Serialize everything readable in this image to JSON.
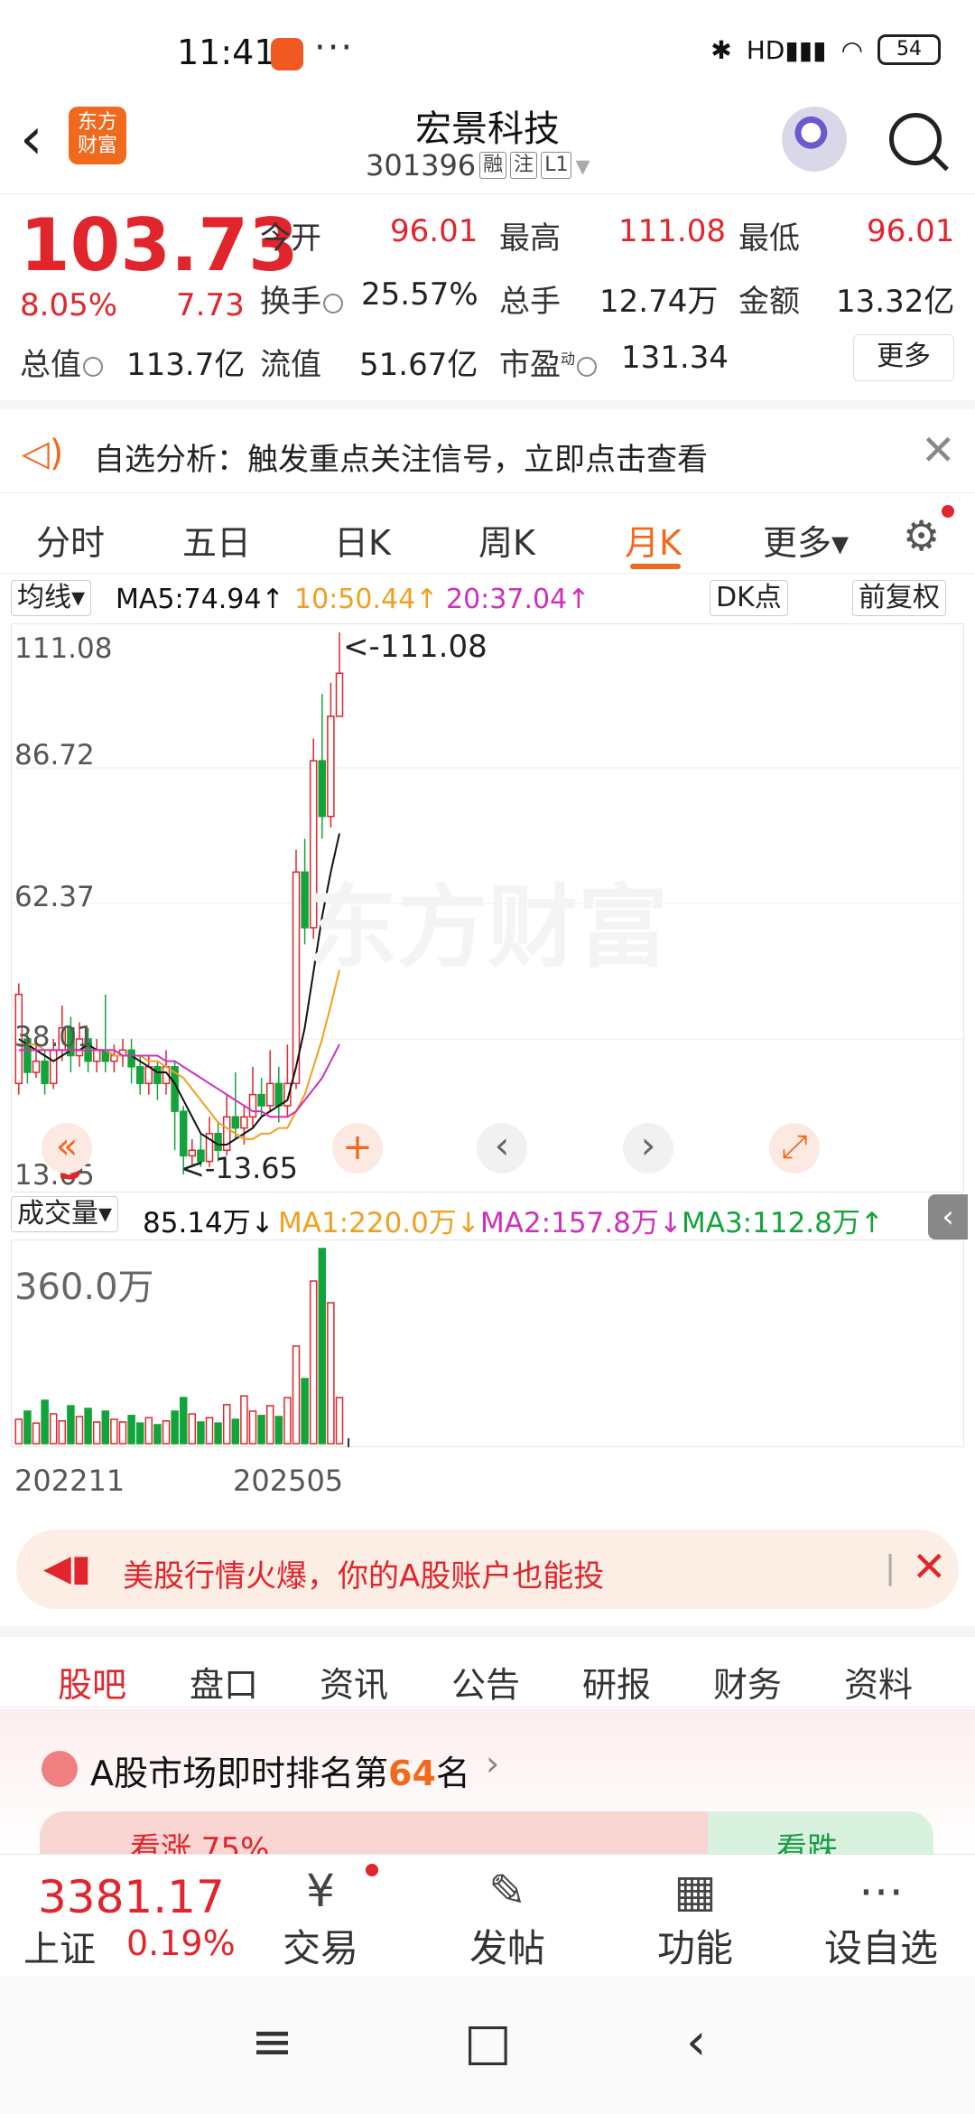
{
  "status": {
    "time": "11:41",
    "dots": "···",
    "network": "HD",
    "battery": "54"
  },
  "header": {
    "back": "‹",
    "logo": "东方\n财富",
    "name": "宏景科技",
    "code": "301396",
    "tags": [
      "融",
      "注",
      "L1"
    ],
    "dropdown": "▾"
  },
  "quote": {
    "price": "103.73",
    "pct": "8.05%",
    "chg": "7.73",
    "rows": [
      [
        {
          "l": "今开",
          "v": "96.01",
          "c": "red"
        },
        {
          "l": "最高",
          "v": "111.08",
          "c": "red"
        },
        {
          "l": "最低",
          "v": "96.01",
          "c": "red"
        }
      ],
      [
        {
          "l": "换手",
          "v": "25.57%",
          "c": "black"
        },
        {
          "l": "总手",
          "v": "12.74万",
          "c": "black"
        },
        {
          "l": "金额",
          "v": "13.32亿",
          "c": "black"
        }
      ],
      [
        {
          "l": "总值",
          "v": "113.7亿",
          "c": "black"
        },
        {
          "l": "流值",
          "v": "51.67亿",
          "c": "black"
        },
        {
          "l": "市盈",
          "v": "131.34",
          "c": "black"
        }
      ]
    ],
    "pe_super": "动",
    "more": "更多"
  },
  "notice": {
    "text": "自选分析：触发重点关注信号，立即点击查看",
    "close": "✕"
  },
  "ktabs": {
    "items": [
      "分时",
      "五日",
      "日K",
      "周K",
      "月K",
      "更多▾"
    ],
    "active": 4
  },
  "malegend": {
    "mode": "均线▾",
    "ma5": "MA5:74.94↑",
    "ma10": "10:50.44↑",
    "ma20": "20:37.04↑",
    "dk": "DK点",
    "adj": "前复权"
  },
  "price_axis": [
    "111.08",
    "86.72",
    "62.37",
    "38.01",
    "13.65"
  ],
  "annotations": {
    "high": "<-111.08",
    "low": "<-13.65",
    "s_marker": "S"
  },
  "watermark": "东方财富",
  "chart_controls": [
    "«",
    "+",
    "‹",
    "›",
    "⤢"
  ],
  "vollegend": {
    "mode": "成交量▾",
    "vol": "85.14万↓",
    "ma1": "MA1:220.0万↓",
    "ma2": "MA2:157.8万↓",
    "ma3": "MA3:112.8万↑"
  },
  "vol_axis": {
    "max": "360.0万"
  },
  "date_axis": [
    "202211",
    "202505"
  ],
  "banner": {
    "text": "美股行情火爆，你的A股账户也能投",
    "close": "✕"
  },
  "btabs": {
    "items": [
      "股吧",
      "盘口",
      "资讯",
      "公告",
      "研报",
      "财务",
      "资料"
    ],
    "active": 0
  },
  "rank": {
    "prefix": "A股市场即时排名第",
    "num": "64",
    "suffix": "名",
    "chev": "›"
  },
  "vote": {
    "up": "看涨 75%",
    "down": "看跌"
  },
  "nav": {
    "index_value": "3381.17",
    "index_name": "上证",
    "index_pct": "0.19%",
    "items": [
      {
        "icon": "¥",
        "label": "交易"
      },
      {
        "icon": "✎",
        "label": "发帖"
      },
      {
        "icon": "▦",
        "label": "功能"
      },
      {
        "icon": "⋯",
        "label": "设自选"
      }
    ]
  },
  "colors": {
    "up": "#e0252c",
    "down": "#12a43a",
    "accent": "#f06a1e",
    "ma5": "#111111",
    "ma10": "#f0a020",
    "ma20": "#d02fbd"
  },
  "chart_data": {
    "type": "candlestick",
    "title": "",
    "y_range": [
      13.65,
      111.08
    ],
    "high": 111.08,
    "low": 13.65,
    "last": {
      "open": 96.01,
      "high": 111.08,
      "low": 96.01,
      "close": 103.73
    },
    "date_ticks": [
      "202211",
      "202505"
    ],
    "volume_range": [
      0,
      3600000
    ],
    "candles": [
      {
        "o": 30,
        "c": 46,
        "h": 48,
        "l": 28
      },
      {
        "o": 38,
        "c": 32,
        "h": 40,
        "l": 30
      },
      {
        "o": 32,
        "c": 34,
        "h": 38,
        "l": 31
      },
      {
        "o": 34,
        "c": 30,
        "h": 36,
        "l": 28
      },
      {
        "o": 30,
        "c": 36,
        "h": 38,
        "l": 29
      },
      {
        "o": 36,
        "c": 40,
        "h": 44,
        "l": 34
      },
      {
        "o": 40,
        "c": 35,
        "h": 42,
        "l": 32
      },
      {
        "o": 35,
        "c": 38,
        "h": 41,
        "l": 33
      },
      {
        "o": 38,
        "c": 34,
        "h": 40,
        "l": 32
      },
      {
        "o": 34,
        "c": 36,
        "h": 38,
        "l": 32
      },
      {
        "o": 36,
        "c": 34,
        "h": 46,
        "l": 32
      },
      {
        "o": 34,
        "c": 35,
        "h": 37,
        "l": 32
      },
      {
        "o": 35,
        "c": 36,
        "h": 38,
        "l": 33
      },
      {
        "o": 36,
        "c": 33,
        "h": 38,
        "l": 30
      },
      {
        "o": 33,
        "c": 30,
        "h": 35,
        "l": 28
      },
      {
        "o": 30,
        "c": 33,
        "h": 35,
        "l": 28
      },
      {
        "o": 33,
        "c": 30,
        "h": 34,
        "l": 27
      },
      {
        "o": 30,
        "c": 33,
        "h": 36,
        "l": 28
      },
      {
        "o": 33,
        "c": 25,
        "h": 34,
        "l": 18
      },
      {
        "o": 25,
        "c": 17,
        "h": 26,
        "l": 13.65
      },
      {
        "o": 17,
        "c": 18,
        "h": 20,
        "l": 15
      },
      {
        "o": 18,
        "c": 16,
        "h": 21,
        "l": 15
      },
      {
        "o": 16,
        "c": 21,
        "h": 24,
        "l": 15
      },
      {
        "o": 21,
        "c": 18,
        "h": 23,
        "l": 16
      },
      {
        "o": 18,
        "c": 24,
        "h": 28,
        "l": 17
      },
      {
        "o": 24,
        "c": 22,
        "h": 32,
        "l": 20
      },
      {
        "o": 22,
        "c": 24,
        "h": 26,
        "l": 19
      },
      {
        "o": 24,
        "c": 28,
        "h": 33,
        "l": 22
      },
      {
        "o": 28,
        "c": 26,
        "h": 31,
        "l": 24
      },
      {
        "o": 26,
        "c": 30,
        "h": 36,
        "l": 25
      },
      {
        "o": 30,
        "c": 26,
        "h": 33,
        "l": 23
      },
      {
        "o": 26,
        "c": 30,
        "h": 37,
        "l": 24
      },
      {
        "o": 30,
        "c": 68,
        "h": 72,
        "l": 29
      },
      {
        "o": 68,
        "c": 58,
        "h": 74,
        "l": 55
      },
      {
        "o": 58,
        "c": 88,
        "h": 92,
        "l": 56
      },
      {
        "o": 88,
        "c": 78,
        "h": 100,
        "l": 74
      },
      {
        "o": 78,
        "c": 96,
        "h": 102,
        "l": 76
      },
      {
        "o": 96.01,
        "c": 103.73,
        "h": 111.08,
        "l": 96.01
      }
    ],
    "volume": [
      45,
      60,
      38,
      80,
      55,
      42,
      70,
      50,
      65,
      40,
      60,
      45,
      40,
      52,
      38,
      48,
      35,
      42,
      60,
      85,
      55,
      40,
      48,
      38,
      72,
      45,
      88,
      60,
      52,
      70,
      50,
      85,
      180,
      120,
      300,
      360,
      260,
      85.14
    ],
    "series": [
      {
        "name": "MA5",
        "values": [
          38,
          37,
          36,
          35,
          34,
          35,
          36,
          36,
          37,
          36,
          36,
          35,
          35,
          35,
          34,
          33,
          32,
          32,
          30,
          27,
          24,
          21,
          20,
          19,
          19,
          20,
          21,
          22,
          24,
          25,
          26,
          27,
          33,
          40,
          50,
          60,
          68,
          74.94
        ]
      },
      {
        "name": "MA10",
        "values": [
          37,
          37,
          37,
          36,
          36,
          36,
          36,
          36,
          36,
          36,
          36,
          35,
          35,
          35,
          35,
          34,
          34,
          33,
          32,
          31,
          29,
          27,
          25,
          23,
          22,
          21,
          20,
          20,
          21,
          21,
          22,
          22,
          25,
          28,
          33,
          38,
          44,
          50.44
        ]
      },
      {
        "name": "MA20",
        "values": [
          36,
          36,
          36,
          36,
          36,
          36,
          36,
          36,
          36,
          36,
          36,
          36,
          35,
          35,
          35,
          35,
          35,
          34,
          34,
          33,
          32,
          31,
          30,
          29,
          28,
          27,
          26,
          25,
          25,
          24,
          24,
          24,
          25,
          27,
          29,
          31,
          34,
          37.04
        ]
      }
    ]
  }
}
